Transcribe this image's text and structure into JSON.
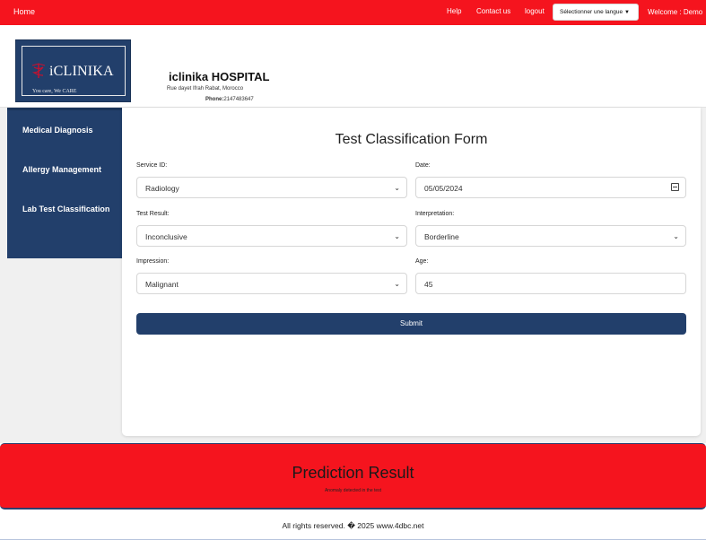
{
  "topbar": {
    "home": "Home",
    "help": "Help",
    "contact": "Contact us",
    "logout": "logout",
    "language_select": "Sélectionner une langue",
    "welcome": "Welcome : Demo"
  },
  "logo": {
    "brand": "iCLINIKA",
    "tagline": "You care, We CARE"
  },
  "hospital": {
    "name": "iclinika HOSPITAL",
    "address": "Rue dayet Ifrah Rabat, Morocco",
    "phone_label": "Phone:",
    "phone_value": "2147483647"
  },
  "sidebar": {
    "items": [
      {
        "label": "Medical Diagnosis"
      },
      {
        "label": "Allergy Management"
      },
      {
        "label": "Lab Test Classification"
      }
    ]
  },
  "form": {
    "title": "Test Classification Form",
    "service_id": {
      "label": "Service ID:",
      "value": "Radiology"
    },
    "date": {
      "label": "Date:",
      "value": "05/05/2024"
    },
    "test_result": {
      "label": "Test Result:",
      "value": "Inconclusive"
    },
    "interpretation": {
      "label": "Interpretation:",
      "value": "Borderline"
    },
    "impression": {
      "label": "Impression:",
      "value": "Malignant"
    },
    "age": {
      "label": "Age:",
      "value": "45"
    },
    "submit_label": "Submit"
  },
  "result": {
    "title": "Prediction Result",
    "message": "Anomaly detected in the test"
  },
  "footer": {
    "text": "All rights reserved. � 2025 www.4dbc.net"
  },
  "colors": {
    "accent_red": "#f5141e",
    "navy": "#223f6b"
  },
  "icons": {
    "dropdown": "chevron-down-icon",
    "language_dropdown": "triangle-down-icon",
    "date": "calendar-icon",
    "logo_mark": "caduceus-icon"
  }
}
